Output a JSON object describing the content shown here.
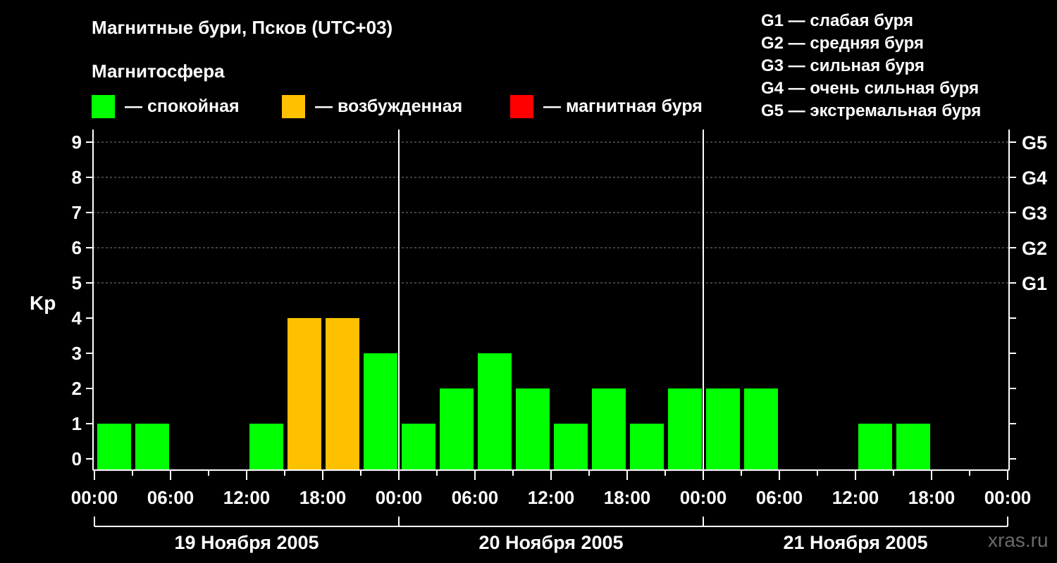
{
  "title": "Магнитные бури, Псков (UTC+03)",
  "legend": {
    "title": "Магнитосфера",
    "items": [
      {
        "label": "— спокойная",
        "color": "#00ff00"
      },
      {
        "label": "— возбужденная",
        "color": "#ffc000"
      },
      {
        "label": "— магнитная буря",
        "color": "#ff0000"
      }
    ]
  },
  "g_legend": [
    "G1 — слабая буря",
    "G2 — средняя буря",
    "G3 — сильная буря",
    "G4 — очень сильная буря",
    "G5 — экстремальная буря"
  ],
  "watermark": "xras.ru",
  "chart_data": {
    "type": "bar",
    "ylabel": "Kp",
    "ylim": [
      0,
      9
    ],
    "yticks": [
      "0",
      "1",
      "2",
      "3",
      "4",
      "5",
      "6",
      "7",
      "8",
      "9"
    ],
    "right_axis": [
      {
        "value": 5,
        "label": "G1"
      },
      {
        "value": 6,
        "label": "G2"
      },
      {
        "value": 7,
        "label": "G3"
      },
      {
        "value": 8,
        "label": "G4"
      },
      {
        "value": 9,
        "label": "G5"
      }
    ],
    "xtick_labels": [
      "00:00",
      "06:00",
      "12:00",
      "18:00",
      "00:00",
      "06:00",
      "12:00",
      "18:00",
      "00:00",
      "06:00",
      "12:00",
      "18:00",
      "00:00"
    ],
    "days": [
      "19 Ноября 2005",
      "20 Ноября 2005",
      "21 Ноября 2005"
    ],
    "interval_hours": 3,
    "values": [
      1,
      1,
      0,
      0,
      1,
      4,
      4,
      3,
      1,
      2,
      3,
      2,
      1,
      2,
      1,
      2,
      2,
      2,
      0,
      0,
      1,
      1,
      0,
      0
    ],
    "status": [
      "quiet",
      "quiet",
      "quiet",
      "quiet",
      "quiet",
      "disturbed",
      "disturbed",
      "quiet",
      "quiet",
      "quiet",
      "quiet",
      "quiet",
      "quiet",
      "quiet",
      "quiet",
      "quiet",
      "quiet",
      "quiet",
      "quiet",
      "quiet",
      "quiet",
      "quiet",
      "quiet",
      "quiet"
    ],
    "colors": {
      "quiet": "#00ff00",
      "disturbed": "#ffc000",
      "storm": "#ff0000"
    },
    "grid": "dashed at Kp 5–9"
  }
}
